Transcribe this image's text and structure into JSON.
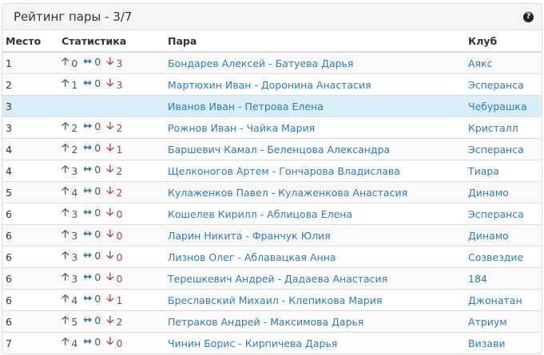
{
  "title": "Рейтинг пары - 3/7",
  "help_icon": "?",
  "columns": [
    "Место",
    "Статистика",
    "Пара",
    "Клуб"
  ],
  "rows": [
    {
      "place": "1",
      "up": "0",
      "eq": "0",
      "down": "3",
      "pair": "Бондарев Алексей - Батуева Дарья",
      "club": "Аякс"
    },
    {
      "place": "2",
      "up": "1",
      "eq": "0",
      "down": "3",
      "pair": "Мартюхин Иван - Доронина Анастасия",
      "club": "Эсперанса"
    },
    {
      "place": "3",
      "up": "",
      "eq": "",
      "down": "",
      "pair": "Иванов Иван - Петрова Елена",
      "club": "Чебурашка",
      "highlight": true
    },
    {
      "place": "3",
      "up": "2",
      "eq": "0",
      "down": "2",
      "pair": "Рожнов Иван - Чайка Мария",
      "club": "Кристалл"
    },
    {
      "place": "4",
      "up": "2",
      "eq": "0",
      "down": "1",
      "pair": "Баршевич Камал - Беленцова Александра",
      "club": "Эсперанса"
    },
    {
      "place": "4",
      "up": "3",
      "eq": "0",
      "down": "2",
      "pair": "Щелконогов Артем - Гончарова Владислава",
      "club": "Тиара"
    },
    {
      "place": "5",
      "up": "4",
      "eq": "0",
      "down": "2",
      "pair": "Кулаженков Павел - Кулаженкова Анастасия",
      "club": "Динамо"
    },
    {
      "place": "6",
      "up": "3",
      "eq": "0",
      "down": "0",
      "pair": "Кошелев Кирилл - Аблицова Елена",
      "club": "Эсперанса"
    },
    {
      "place": "6",
      "up": "3",
      "eq": "0",
      "down": "0",
      "pair": "Ларин Никита - Франчук Юлия",
      "club": "Динамо"
    },
    {
      "place": "6",
      "up": "3",
      "eq": "0",
      "down": "0",
      "pair": "Лизнов Олег - Аблавацкая Анна",
      "club": "Созвездие"
    },
    {
      "place": "6",
      "up": "3",
      "eq": "0",
      "down": "0",
      "pair": "Терешкевич Андрей - Дадаева Анастасия",
      "club": "184"
    },
    {
      "place": "6",
      "up": "4",
      "eq": "0",
      "down": "1",
      "pair": "Бреславский Михаил - Клепикова Мария",
      "club": "Джонатан"
    },
    {
      "place": "6",
      "up": "5",
      "eq": "0",
      "down": "2",
      "pair": "Петраков Андрей - Максимова Дарья",
      "club": "Атриум"
    },
    {
      "place": "7",
      "up": "4",
      "eq": "0",
      "down": "0",
      "pair": "Чинин Борис - Кирпичева Дарья",
      "club": "Визави"
    }
  ],
  "colors": {
    "link": "#337ab7",
    "up": "#3c763d",
    "down": "#a94442",
    "eq": "#31708f",
    "highlight": "#d9edf7"
  }
}
